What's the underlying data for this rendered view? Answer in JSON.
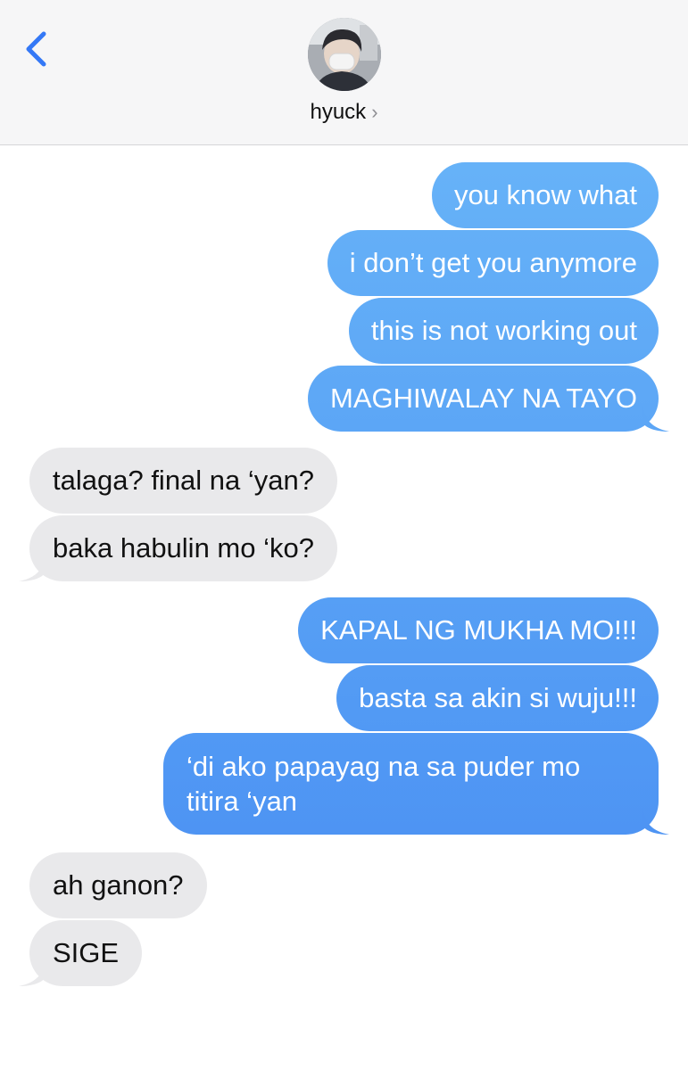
{
  "header": {
    "contact_name": "hyuck",
    "back_icon": "chevron-left-icon",
    "disclosure_icon": "chevron-right-icon",
    "avatar_alt": "contact avatar"
  },
  "colors": {
    "accent": "#3478f6",
    "outgoing_top": "#67b3f8",
    "outgoing_bottom": "#4a90f2",
    "incoming": "#e9e9eb"
  },
  "messages": [
    {
      "direction": "out",
      "text": "you know what"
    },
    {
      "direction": "out",
      "text": "i don’t get you anymore"
    },
    {
      "direction": "out",
      "text": "this is not working out"
    },
    {
      "direction": "out",
      "text": "MAGHIWALAY NA TAYO"
    },
    {
      "direction": "in",
      "text": "talaga? final na ‘yan?"
    },
    {
      "direction": "in",
      "text": "baka habulin mo ‘ko?"
    },
    {
      "direction": "out",
      "text": "KAPAL NG MUKHA MO!!!"
    },
    {
      "direction": "out",
      "text": "basta sa akin si wuju!!!"
    },
    {
      "direction": "out",
      "text": "‘di ako papayag na sa puder mo titira ‘yan"
    },
    {
      "direction": "in",
      "text": "ah ganon?"
    },
    {
      "direction": "in",
      "text": "SIGE"
    }
  ]
}
